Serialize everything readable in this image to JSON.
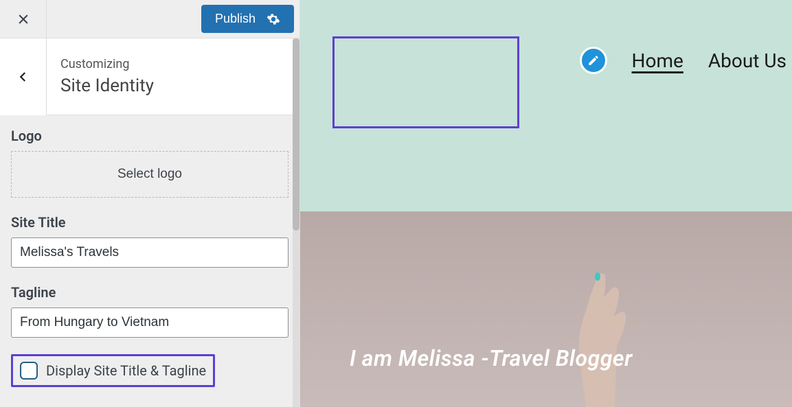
{
  "header": {
    "publish_label": "Publish"
  },
  "section": {
    "subtitle": "Customizing",
    "title": "Site Identity"
  },
  "fields": {
    "logo": {
      "label": "Logo",
      "button_label": "Select logo"
    },
    "site_title": {
      "label": "Site Title",
      "value": "Melissa's Travels"
    },
    "tagline": {
      "label": "Tagline",
      "value": "From Hungary to Vietnam"
    },
    "display_title_tagline": {
      "label": "Display Site Title & Tagline",
      "checked": false
    }
  },
  "preview": {
    "nav": {
      "items": [
        {
          "label": "Home",
          "active": true
        },
        {
          "label": "About Us",
          "active": false
        }
      ]
    },
    "hero_text": "I am Melissa -Travel Blogger"
  },
  "colors": {
    "accent": "#5d3fd3",
    "primary_button": "#2271b1",
    "preview_bg": "#c7e2d8"
  }
}
